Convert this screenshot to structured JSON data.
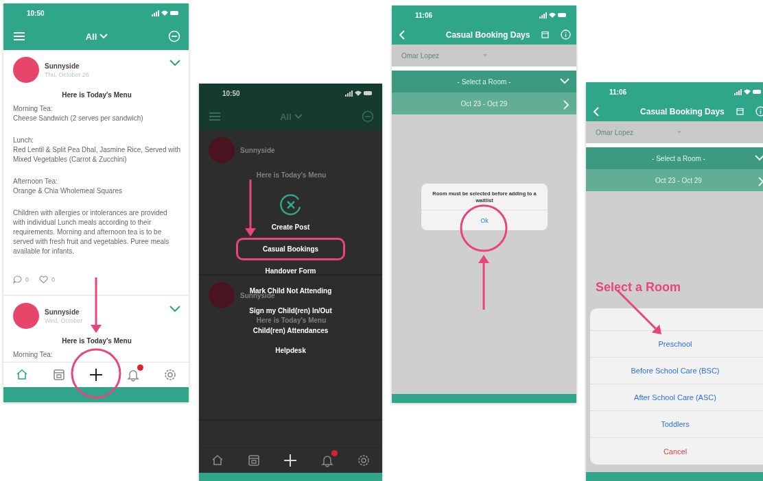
{
  "screens": [
    {
      "kind": "feed",
      "status_time": "10:50",
      "filter": "All",
      "notification_badge": true,
      "posts": [
        {
          "author": "Sunnyside",
          "date": "Thu, October 26",
          "title": "Here is Today's Menu",
          "paragraphs": [
            [
              "Morning Tea:",
              "Cheese Sandwich (2 serves per sandwich)"
            ],
            [
              "Lunch:",
              "Red Lentil & Split Pea Dhal, Jasmine Rice, Served with Mixed Vegetables (Carrot & Zucchini)"
            ],
            [
              "Afternoon Tea:",
              "Orange & Chia Wholemeal Squares"
            ],
            [
              "Children with allergies or intolerances are provided with individual Lunch meals according to their requirements. Morning and afternoon tea is to be served with fresh fruit and vegetables. Puree meals available for infants."
            ]
          ],
          "comments": "0",
          "likes": "0"
        },
        {
          "author": "Sunnyside",
          "date": "Wed, October",
          "title": "Here is Today's Menu",
          "paragraphs": [
            [
              "Morning Tea:"
            ]
          ]
        }
      ],
      "nav": [
        {
          "selected": true
        },
        {
          "selected": false
        },
        {
          "selected": false
        },
        {
          "selected": false
        },
        {
          "selected": false
        }
      ]
    },
    {
      "kind": "menu",
      "status_time": "10:50",
      "filter": "All",
      "notification_badge": true,
      "background_posts": [
        {
          "author": "Sunnyside",
          "title": "Here is Today's Menu"
        },
        {
          "author": "Sunnyside",
          "title": "Here is Today's Menu"
        }
      ],
      "menu_items": [
        {
          "label": "Create Post",
          "highlighted": false
        },
        {
          "label": "Casual Bookings",
          "highlighted": true
        },
        {
          "label": "Handover Form",
          "highlighted": false
        },
        {
          "label": "Mark Child Not Attending",
          "highlighted": false
        },
        {
          "label": "Sign my Child(ren) In/Out",
          "highlighted": false
        },
        {
          "label": "Child(ren) Attendances",
          "highlighted": false
        },
        {
          "label": "Helpdesk",
          "highlighted": false
        }
      ]
    },
    {
      "kind": "booking",
      "status_time": "11:06",
      "title": "Casual Booking Days",
      "child": "Omar Lopez",
      "room": "- Select a Room -",
      "week": "Oct 23 - Oct 29",
      "alert": {
        "message": "Room must be selected before adding to a waitlist",
        "button": "Ok"
      }
    },
    {
      "kind": "booking",
      "status_time": "11:06",
      "title": "Casual Booking Days",
      "child": "Omar Lopez",
      "room": "- Select a Room -",
      "week": "Oct 23 - Oct 29",
      "callout": "Select a Room",
      "sheet": [
        {
          "label": "Preschool",
          "kind": "option"
        },
        {
          "label": "Before School Care (BSC)",
          "kind": "option"
        },
        {
          "label": "After School Care (ASC)",
          "kind": "option"
        },
        {
          "label": "Toddlers",
          "kind": "option"
        },
        {
          "label": "Cancel",
          "kind": "cancel"
        }
      ]
    }
  ]
}
